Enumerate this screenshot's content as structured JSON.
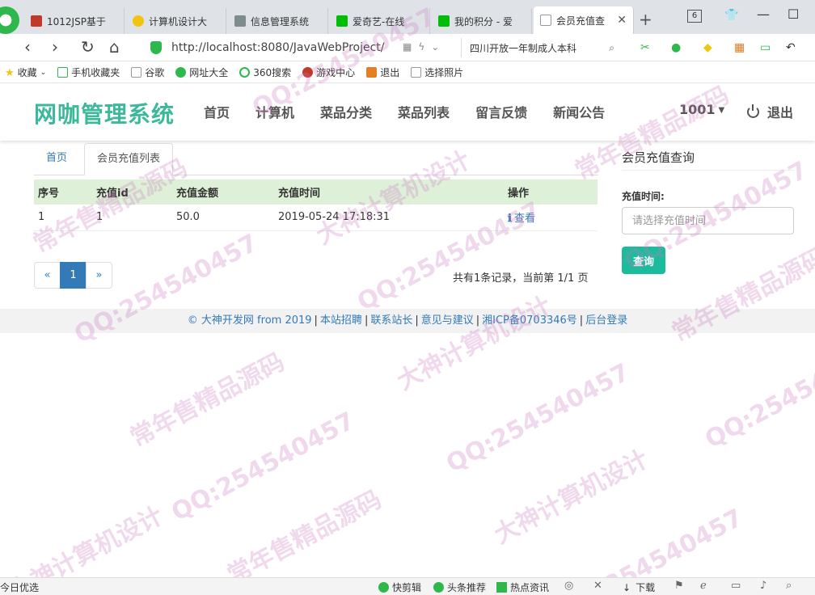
{
  "browser": {
    "tabs": [
      {
        "label": "1012JSP基于",
        "color": "#c0392b"
      },
      {
        "label": "计算机设计大",
        "color": "#f1c40f"
      },
      {
        "label": "信息管理系统",
        "color": "#7f8c8d"
      },
      {
        "label": "爱奇艺-在线",
        "color": "#00be06"
      },
      {
        "label": "我的积分 - 爱",
        "color": "#00be06"
      },
      {
        "label": "会员充值查",
        "color": "#ffffff"
      }
    ],
    "tab_count": "6",
    "url": "http://localhost:8080/JavaWebProject/",
    "search_text": "四川开放一年制成人本科",
    "bookmarks": [
      "收藏",
      "手机收藏夹",
      "谷歌",
      "网址大全",
      "360搜索",
      "游戏中心",
      "退出",
      "选择照片"
    ]
  },
  "header": {
    "brand": "网咖管理系统",
    "nav": [
      "首页",
      "计算机",
      "菜品分类",
      "菜品列表",
      "留言反馈",
      "新闻公告"
    ],
    "user": "1001",
    "logout": "退出"
  },
  "content": {
    "tabs": {
      "home": "首页",
      "current": "会员充值列表"
    },
    "table": {
      "headers": [
        "序号",
        "充值id",
        "充值金额",
        "充值时间",
        "操作"
      ],
      "rows": [
        {
          "index": "1",
          "id": "1",
          "amount": "50.0",
          "time": "2019-05-24 17:18:31",
          "action": "查看"
        }
      ]
    },
    "pager": {
      "prev": "«",
      "current": "1",
      "next": "»",
      "info": "共有1条记录，当前第 1/1 页"
    }
  },
  "sidebar": {
    "title": "会员充值查询",
    "label": "充值时间:",
    "placeholder": "请选择充值时间",
    "button": "查询"
  },
  "footer": {
    "copyright": "© 大神开发网 from 2019",
    "links": [
      "本站招聘",
      "联系站长",
      "意见与建议",
      "湘ICP备0703346号",
      "后台登录"
    ]
  },
  "watermarks": [
    "常年售精品源码",
    "QQ:254540457",
    "大神计算机设计"
  ],
  "statusbar": {
    "left": "今日优选",
    "items": [
      "快剪辑",
      "头条推荐",
      "热点资讯",
      "下载"
    ]
  },
  "colors": {
    "brand": "#3cb89a",
    "link": "#337ab7",
    "table_header": "#dff0d8",
    "button": "#1abc9c"
  }
}
